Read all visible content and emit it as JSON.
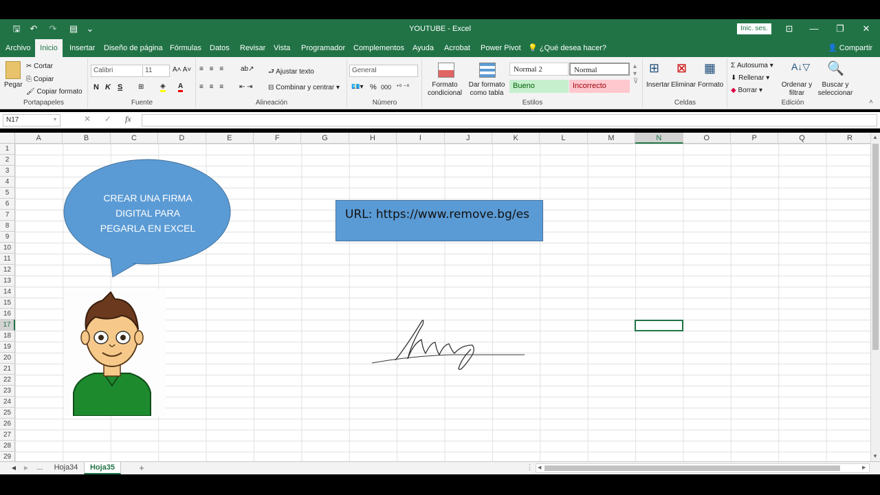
{
  "window": {
    "title": "YOUTUBE  -  Excel",
    "signin": "Inic. ses.",
    "min": "—",
    "restore": "❐",
    "close": "✕",
    "ribbon_opts": "⊡"
  },
  "qat": {
    "save": "🖫",
    "undo": "↶",
    "redo": "↷",
    "customize": "⌄"
  },
  "tabs": [
    "Archivo",
    "Inicio",
    "Insertar",
    "Diseño de página",
    "Fórmulas",
    "Datos",
    "Revisar",
    "Vista",
    "Programador",
    "Complementos",
    "Ayuda",
    "Acrobat",
    "Power Pivot"
  ],
  "tell_me": "¿Qué desea hacer?",
  "share": "Compartir",
  "ribbon": {
    "clipboard": {
      "label": "Portapapeles",
      "paste": "Pegar",
      "cut": "Cortar",
      "copy": "Copiar",
      "format_painter": "Copiar formato"
    },
    "font": {
      "label": "Fuente",
      "name": "Calibri",
      "size": "11",
      "bold": "N",
      "italic": "K",
      "underline": "S"
    },
    "alignment": {
      "label": "Alineación",
      "wrap": "Ajustar texto",
      "merge": "Combinar y centrar"
    },
    "number": {
      "label": "Número",
      "format": "General",
      "percent": "%",
      "thousands": "000"
    },
    "styles": {
      "label": "Estilos",
      "cond": "Formato condicional",
      "table": "Dar formato como tabla",
      "s1": "Normal 2",
      "s2": "Normal",
      "s3": "Bueno",
      "s4": "Incorrecto"
    },
    "cells": {
      "label": "Celdas",
      "insert": "Insertar",
      "delete": "Eliminar",
      "format": "Formato"
    },
    "editing": {
      "label": "Edición",
      "autosum": "Autosuma",
      "fill": "Rellenar",
      "clear": "Borrar",
      "sort": "Ordenar y filtrar",
      "find": "Buscar y seleccionar"
    }
  },
  "formula": {
    "cell": "N17",
    "cancel": "✕",
    "enter": "✓",
    "fx": "fx",
    "value": ""
  },
  "columns": [
    "A",
    "B",
    "C",
    "D",
    "E",
    "F",
    "G",
    "H",
    "I",
    "J",
    "K",
    "L",
    "M",
    "N",
    "O",
    "P",
    "Q",
    "R"
  ],
  "rows": [
    "1",
    "2",
    "3",
    "4",
    "5",
    "6",
    "7",
    "8",
    "9",
    "10",
    "11",
    "12",
    "13",
    "14",
    "15",
    "16",
    "17",
    "18",
    "19",
    "20",
    "21",
    "22",
    "23",
    "24",
    "25",
    "26",
    "27",
    "28",
    "29"
  ],
  "selected": {
    "column": "N",
    "row": "17"
  },
  "shapes": {
    "bubble_line1": "CREAR UNA FIRMA",
    "bubble_line2": "DIGITAL PARA",
    "bubble_line3": "PEGARLA EN EXCEL",
    "url_label": "URL: https://www.remove.bg/es"
  },
  "sheets": {
    "more": "...",
    "tab1": "Hoja34",
    "tab2": "Hoja35",
    "add": "+"
  },
  "colors": {
    "excel_green": "#217346",
    "shape_blue": "#5b9bd5",
    "shirt_green": "#1e8a2e"
  }
}
